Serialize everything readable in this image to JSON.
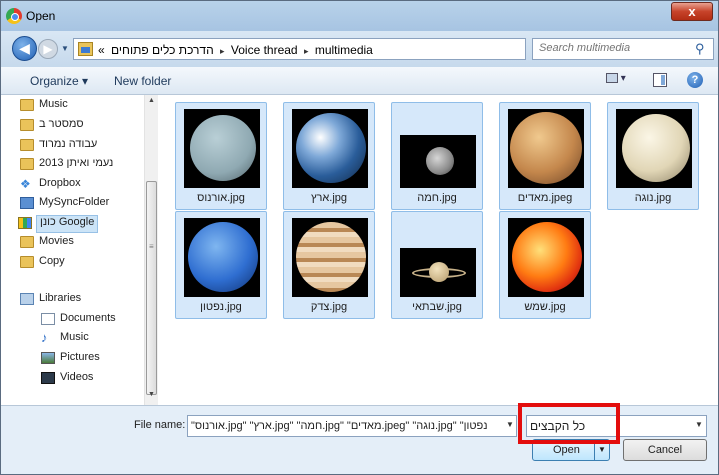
{
  "window": {
    "title": "Open",
    "close_label": "x"
  },
  "address": {
    "crumbs": [
      "«",
      "הדרכת כלים פתוחים",
      "Voice thread",
      "multimedia"
    ],
    "separator": "▸"
  },
  "search": {
    "placeholder": "Search multimedia"
  },
  "toolbar": {
    "organize_label": "Organize ▾",
    "new_folder_label": "New folder"
  },
  "sidebar": {
    "items": [
      {
        "label": "Music",
        "icon": "folder-icon"
      },
      {
        "label": "סמסטר ב",
        "icon": "folder-icon"
      },
      {
        "label": "עבודה נמרוד",
        "icon": "folder-icon"
      },
      {
        "label": "נעמי ואיתן 2013",
        "icon": "folder-icon"
      },
      {
        "label": "Dropbox",
        "icon": "dropbox-icon"
      },
      {
        "label": "MySyncFolder",
        "icon": "sync-folder-icon"
      },
      {
        "label": "כונן Google",
        "icon": "google-drive-icon",
        "selected": true
      },
      {
        "label": "Movies",
        "icon": "folder-icon"
      },
      {
        "label": "Copy",
        "icon": "copy-icon"
      }
    ],
    "libraries": {
      "label": "Libraries",
      "items": [
        {
          "label": "Documents",
          "icon": "documents-icon"
        },
        {
          "label": "Music",
          "icon": "music-icon"
        },
        {
          "label": "Pictures",
          "icon": "pictures-icon"
        },
        {
          "label": "Videos",
          "icon": "videos-icon"
        }
      ]
    }
  },
  "files": [
    {
      "name": "אורנוס.jpg",
      "planet": "uranus"
    },
    {
      "name": "ארץ.jpg",
      "planet": "earth"
    },
    {
      "name": "חמה.jpg",
      "planet": "mercury"
    },
    {
      "name": "מאדים.jpeg",
      "planet": "mars"
    },
    {
      "name": "נוגה.jpg",
      "planet": "venus"
    },
    {
      "name": "נפטון.jpg",
      "planet": "neptune"
    },
    {
      "name": "צדק.jpg",
      "planet": "jupiter"
    },
    {
      "name": "שבתאי.jpg",
      "planet": "saturn"
    },
    {
      "name": "שמש.jpg",
      "planet": "sun"
    }
  ],
  "bottom": {
    "file_name_label": "File name:",
    "file_name_value": "\"אורנוס.jpg\" \"ארץ.jpg\" \"חמה.jpg\" \"מאדים.jpeg\" \"נוגה.jpg\" \"נפטון",
    "filter_value": "כל הקבצים",
    "open_label": "Open",
    "cancel_label": "Cancel"
  },
  "colors": {
    "highlight": "#e30d0d",
    "selection": "#d6e8fa"
  }
}
